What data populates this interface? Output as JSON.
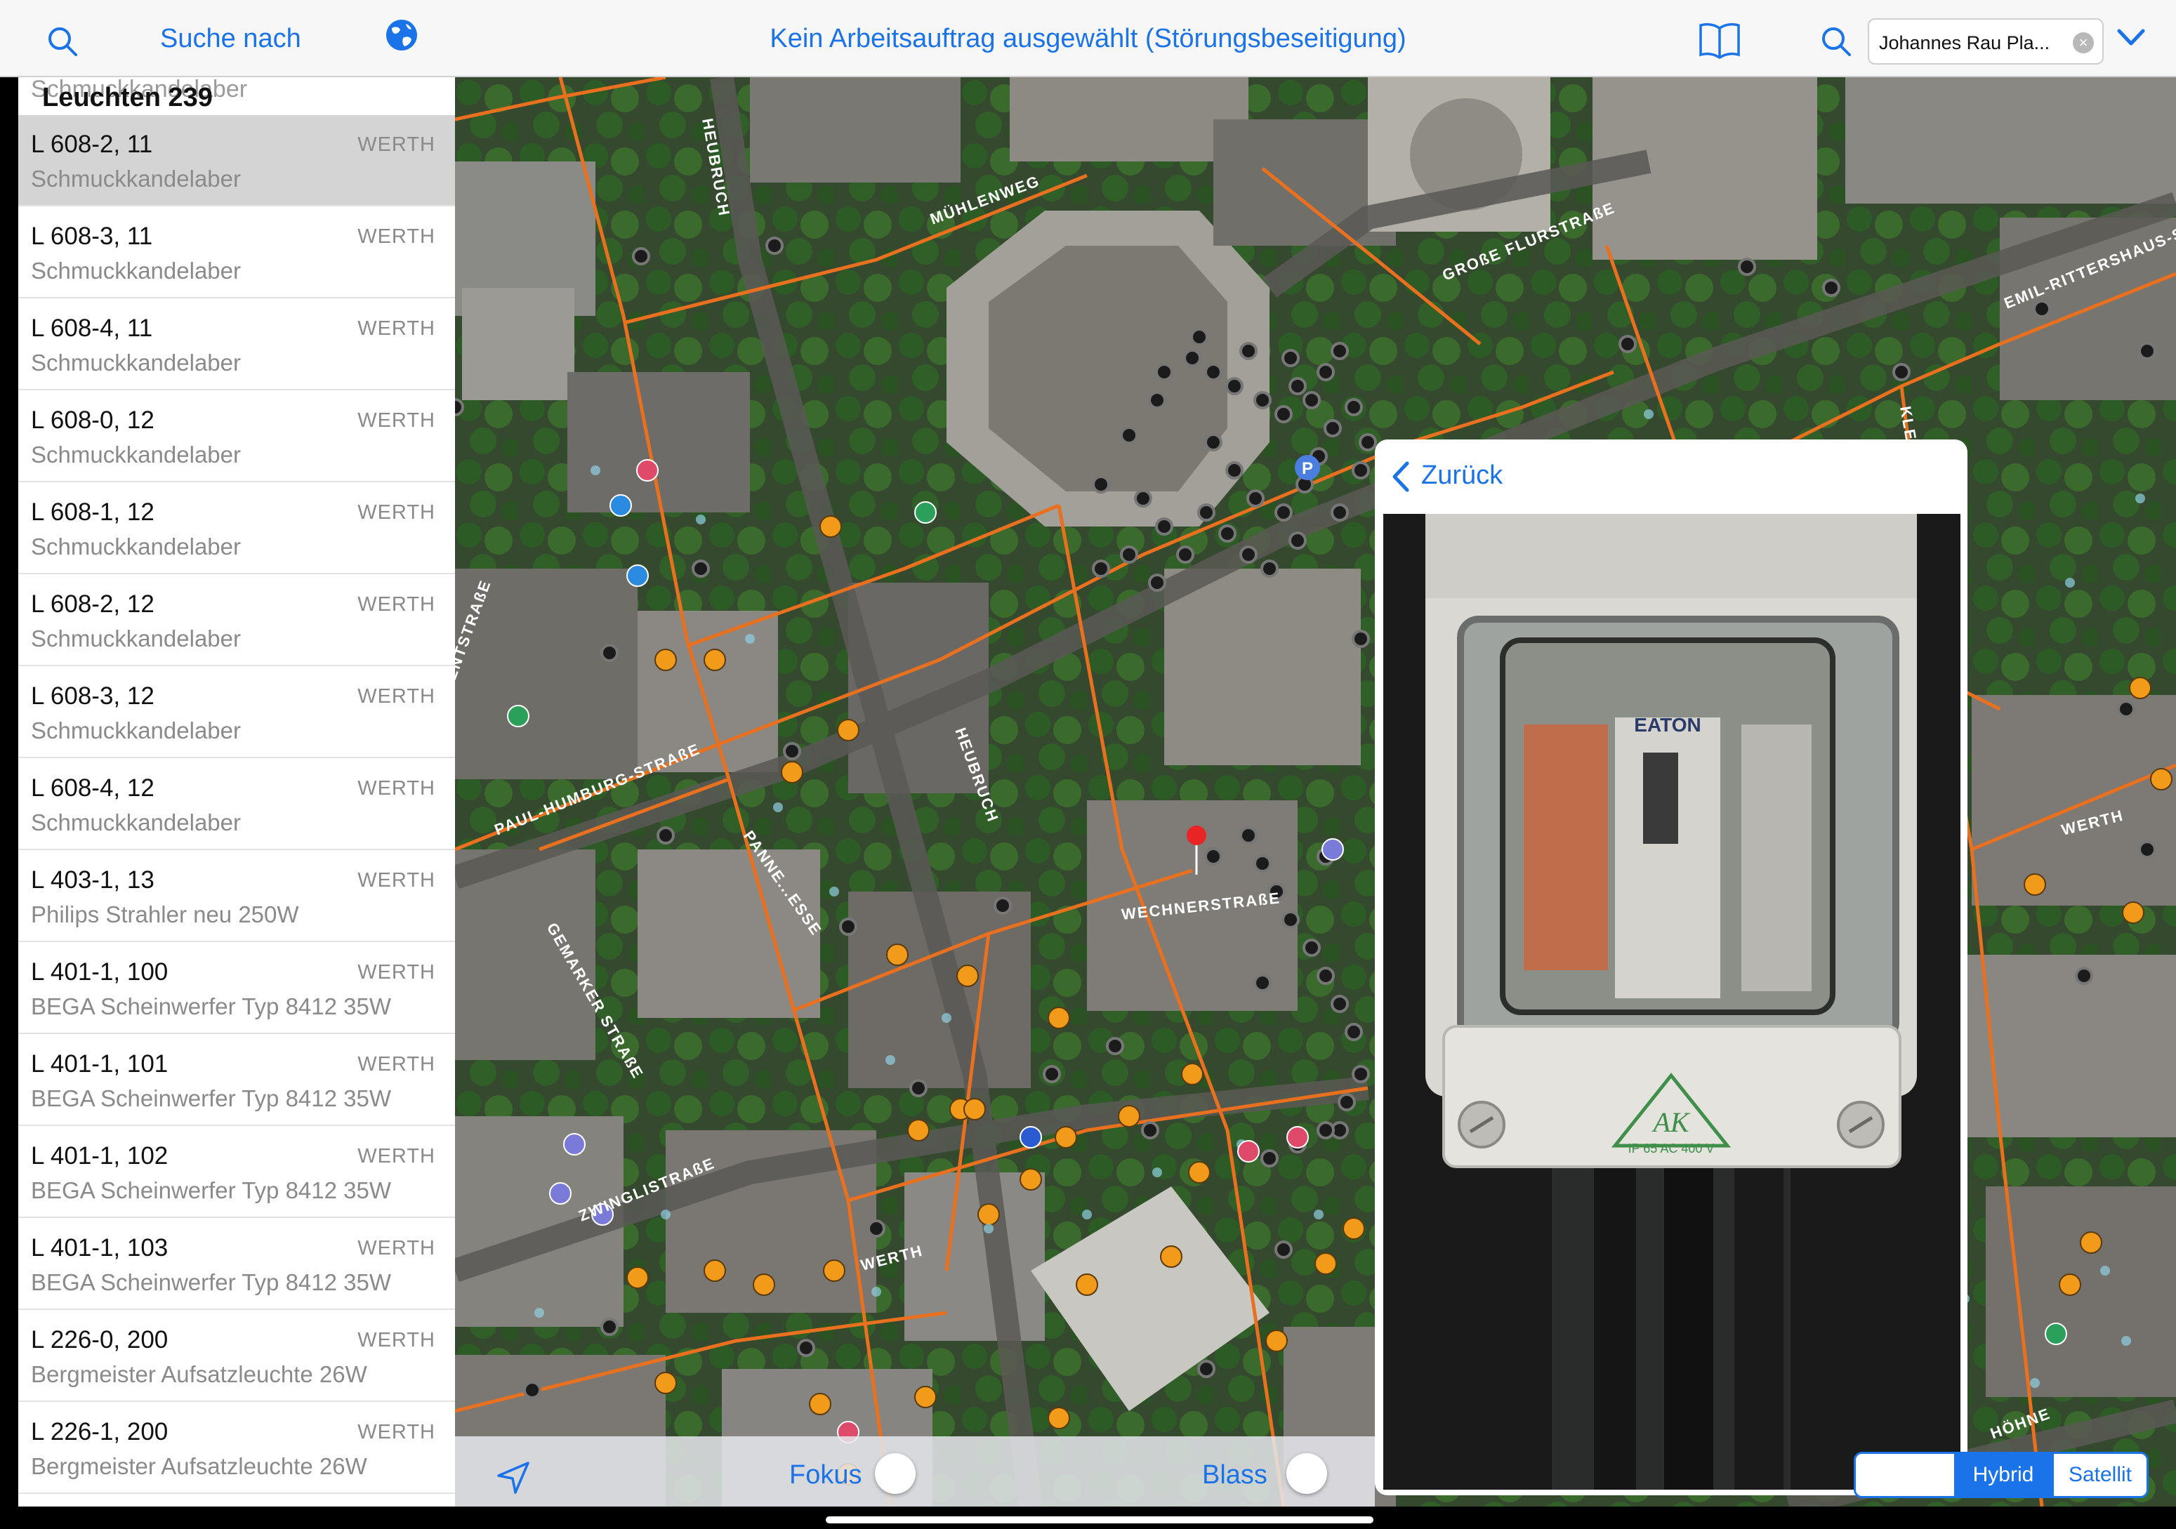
{
  "topbar": {
    "search_label": "Suche nach",
    "title": "Kein Arbeitsauftrag ausgewählt (Störungsbeseitigung)",
    "search_field_value": "Johannes Rau Pla...",
    "clear_label": "×"
  },
  "sidebar": {
    "ghost_text": "Schmuckkandelaber",
    "count_label": "Leuchten 239",
    "items": [
      {
        "code": "L 608-2, 11",
        "location": "WERTH",
        "description": "Schmuckkandelaber",
        "selected": true
      },
      {
        "code": "L 608-3, 11",
        "location": "WERTH",
        "description": "Schmuckkandelaber"
      },
      {
        "code": "L 608-4, 11",
        "location": "WERTH",
        "description": "Schmuckkandelaber"
      },
      {
        "code": "L 608-0, 12",
        "location": "WERTH",
        "description": "Schmuckkandelaber"
      },
      {
        "code": "L 608-1, 12",
        "location": "WERTH",
        "description": "Schmuckkandelaber"
      },
      {
        "code": "L 608-2, 12",
        "location": "WERTH",
        "description": "Schmuckkandelaber"
      },
      {
        "code": "L 608-3, 12",
        "location": "WERTH",
        "description": "Schmuckkandelaber"
      },
      {
        "code": "L 608-4, 12",
        "location": "WERTH",
        "description": "Schmuckkandelaber"
      },
      {
        "code": "L 403-1, 13",
        "location": "WERTH",
        "description": "Philips Strahler neu 250W"
      },
      {
        "code": "L 401-1, 100",
        "location": "WERTH",
        "description": "BEGA Scheinwerfer Typ 8412 35W"
      },
      {
        "code": "L 401-1, 101",
        "location": "WERTH",
        "description": "BEGA Scheinwerfer Typ 8412 35W"
      },
      {
        "code": "L 401-1, 102",
        "location": "WERTH",
        "description": "BEGA Scheinwerfer Typ 8412 35W"
      },
      {
        "code": "L 401-1, 103",
        "location": "WERTH",
        "description": "BEGA Scheinwerfer Typ 8412 35W"
      },
      {
        "code": "L 226-0, 200",
        "location": "WERTH",
        "description": "Bergmeister Aufsatzleuchte 26W"
      },
      {
        "code": "L 226-1, 200",
        "location": "WERTH",
        "description": "Bergmeister Aufsatzleuchte 26W"
      }
    ]
  },
  "map": {
    "street_labels": [
      "HEUBRUCH",
      "MÜHLENWEG",
      "GROßE FLURSTRAßE",
      "EMIL-RITTERSHAUS-STR",
      "PAUL-HUMBURG-STRAßE",
      "PANNE...ESSE",
      "HEUBRUCH",
      "WECHNERSTRAßE",
      "GEMARKER STRAßE",
      "ZWINGLISTRAßE",
      "WERTH",
      "WERTH",
      "HÖHNE",
      "KLE",
      "ENTSTRAßE"
    ],
    "parking_label": "P"
  },
  "photo_panel": {
    "back_label": "Zurück",
    "photo_brand": "EATON",
    "photo_mark": "AK",
    "photo_spec": "IP 65  AC 400 V"
  },
  "bottombar": {
    "focus_label": "Fokus",
    "faded_label": "Blass"
  },
  "map_type": {
    "options": [
      "",
      "Hybrid",
      "Satellit"
    ],
    "selected": "Hybrid"
  },
  "colors": {
    "accent": "#1a73e8",
    "cable": "#e8701f",
    "selected_row": "#d4d4d4",
    "map_pin": "#e82424"
  }
}
